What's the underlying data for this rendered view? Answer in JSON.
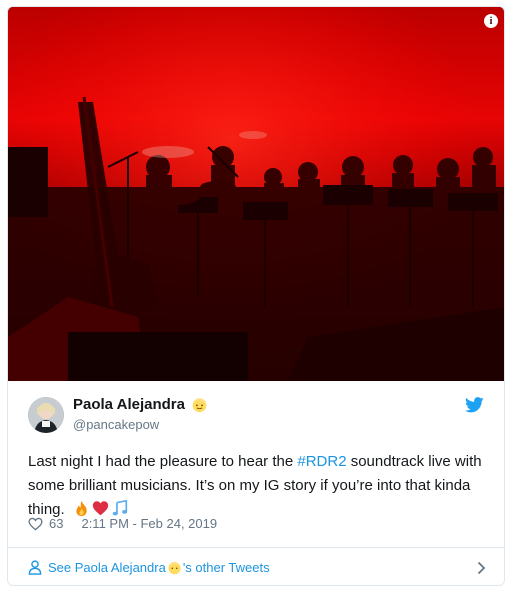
{
  "tweet": {
    "author_name": "Paola Alejandra",
    "author_handle": "@pancakepow",
    "text_before": "Last night I had the pleasure to hear the ",
    "hashtag": "#RDR2",
    "text_after": " soundtrack live with some brilliant musicians. It’s on my IG story if you’re into that kinda thing.",
    "emojis": [
      "fire-emoji",
      "red-heart-emoji",
      "musical-notes-emoji"
    ],
    "like_count": "63",
    "timestamp": "2:11 PM - Feb 24, 2019"
  },
  "media": {
    "info_label": "i",
    "description_colors": {
      "red": "#d40000",
      "dark": "#1c0000"
    }
  },
  "footer": {
    "link_before": "See Paola Alejandra ",
    "link_after": "'s other Tweets"
  },
  "colors": {
    "link": "#1b95e0",
    "muted": "#657786",
    "border": "#e1e8ed",
    "twitter_blue": "#1da1f2"
  }
}
